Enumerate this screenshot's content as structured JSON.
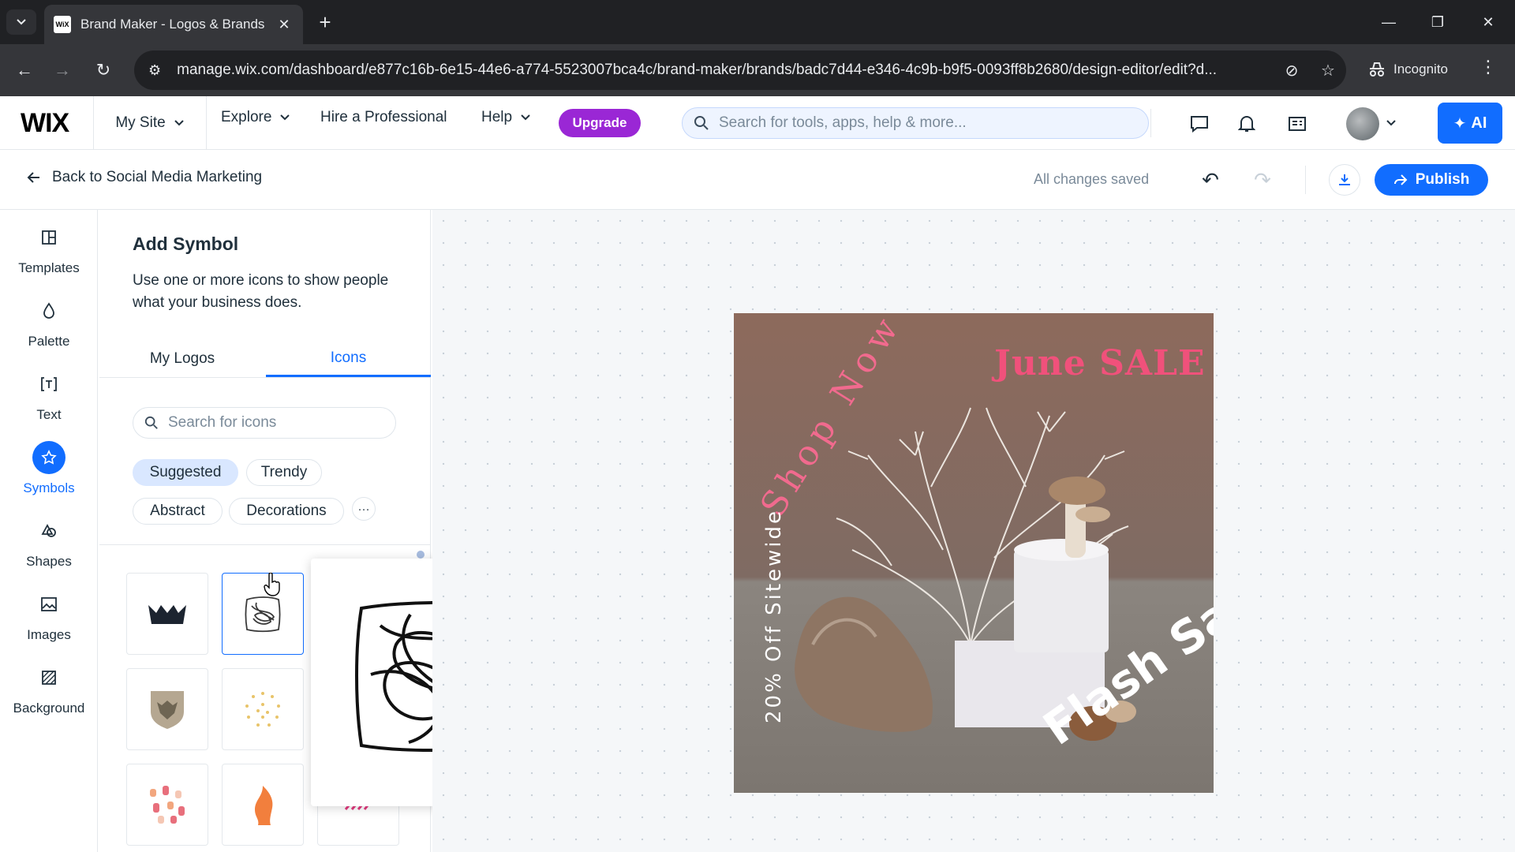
{
  "browser": {
    "tab_title": "Brand Maker - Logos & Brands",
    "favicon_text": "WiX",
    "url": "manage.wix.com/dashboard/e877c16b-6e15-44e6-a774-5523007bca4c/brand-maker/brands/badc7d44-e346-4c9b-b9f5-0093ff8b2680/design-editor/edit?d...",
    "incognito_label": "Incognito"
  },
  "wix_bar": {
    "logo": "WIX",
    "site_label": "My Site",
    "explore": "Explore",
    "hire": "Hire a Professional",
    "help": "Help",
    "upgrade": "Upgrade",
    "search_placeholder": "Search for tools, apps, help & more...",
    "ai_label": "AI"
  },
  "editor_bar": {
    "back_label": "Back to Social Media Marketing",
    "status": "All changes saved",
    "publish_label": "Publish"
  },
  "rail": {
    "items": [
      {
        "label": "Templates",
        "icon": "templates-icon"
      },
      {
        "label": "Palette",
        "icon": "palette-icon"
      },
      {
        "label": "Text",
        "icon": "text-icon"
      },
      {
        "label": "Symbols",
        "icon": "star-icon",
        "active": true
      },
      {
        "label": "Shapes",
        "icon": "shapes-icon"
      },
      {
        "label": "Images",
        "icon": "image-icon"
      },
      {
        "label": "Background",
        "icon": "background-icon"
      }
    ]
  },
  "panel": {
    "title": "Add Symbol",
    "description": "Use one or more icons to show people what your business does.",
    "tabs": [
      "My Logos",
      "Icons"
    ],
    "active_tab": "Icons",
    "search_placeholder": "Search for icons",
    "chips": [
      "Suggested",
      "Trendy",
      "Abstract",
      "Decorations"
    ],
    "selected_chip": "Suggested",
    "icon_tiles": [
      "crown-icon",
      "scribble-icon",
      "lion-shield-icon",
      "dots-circle-icon",
      "confetti-icon",
      "flame-icon",
      "stripes-icon"
    ]
  },
  "design": {
    "headline": "June SALE",
    "arc_text": "Shop Now",
    "side_text": "20% Off Sitewide",
    "corner_text": "Flash Sale"
  },
  "colors": {
    "accent": "#116dff",
    "upgrade": "#9a27d5",
    "sale_pink": "#f0517b",
    "design_bg_top": "#8d6e63",
    "design_bg_bottom": "#8a8580"
  }
}
